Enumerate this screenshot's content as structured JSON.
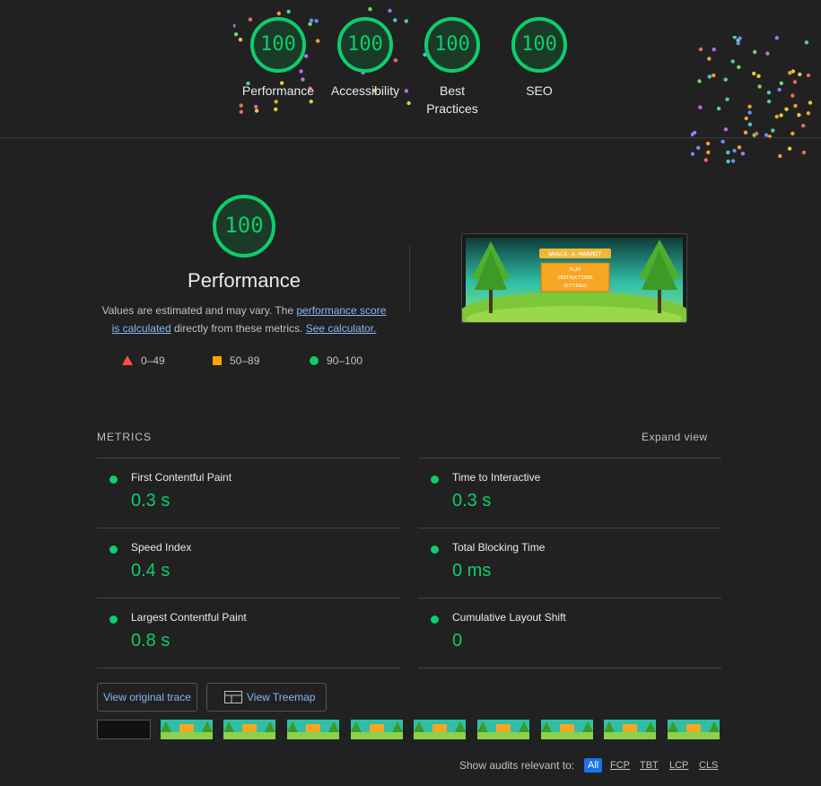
{
  "top_gauges": [
    {
      "score": "100",
      "label": "Performance"
    },
    {
      "score": "100",
      "label": "Accessibility"
    },
    {
      "score": "100",
      "label": "Best Practices"
    },
    {
      "score": "100",
      "label": "SEO"
    }
  ],
  "performance": {
    "score": "100",
    "title": "Performance",
    "desc_prefix": "Values are estimated and may vary. The ",
    "desc_link1": "performance score is calculated",
    "desc_middle": " directly from these metrics. ",
    "desc_link2": "See calculator."
  },
  "legend": {
    "fail": "0–49",
    "average": "50–89",
    "pass": "90–100"
  },
  "screenshot": {
    "banner": "WHACK-A-MARMOT",
    "menu": [
      "PLAY",
      "INSTRUCTIONS",
      "SETTINGS"
    ]
  },
  "metrics": {
    "header": "METRICS",
    "expand": "Expand view",
    "items": [
      {
        "label": "First Contentful Paint",
        "value": "0.3 s"
      },
      {
        "label": "Time to Interactive",
        "value": "0.3 s"
      },
      {
        "label": "Speed Index",
        "value": "0.4 s"
      },
      {
        "label": "Total Blocking Time",
        "value": "0 ms"
      },
      {
        "label": "Largest Contentful Paint",
        "value": "0.8 s"
      },
      {
        "label": "Cumulative Layout Shift",
        "value": "0"
      }
    ]
  },
  "buttons": {
    "trace": "View original trace",
    "treemap": "View Treemap"
  },
  "filter": {
    "label": "Show audits relevant to:",
    "chips": [
      "All",
      "FCP",
      "TBT",
      "LCP",
      "CLS"
    ]
  },
  "colors": {
    "pass": "#0cce6b",
    "average": "#ffa400",
    "fail": "#ff4e42",
    "link": "#8ab4f8",
    "active_chip": "#1a73e8"
  },
  "icons": [
    "triangle-icon",
    "square-icon",
    "circle-icon",
    "treemap-icon"
  ]
}
